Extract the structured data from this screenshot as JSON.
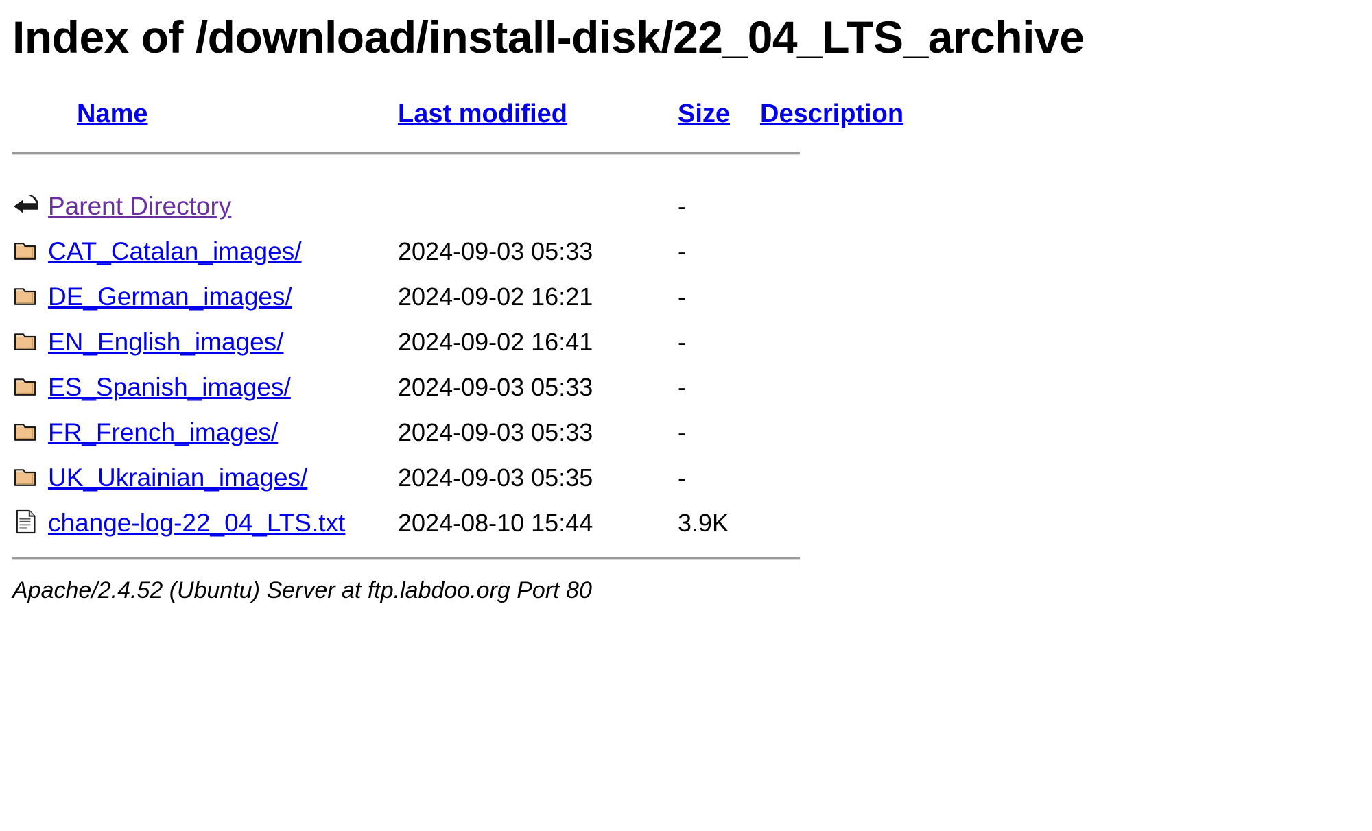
{
  "page": {
    "title": "Index of /download/install-disk/22_04_LTS_archive"
  },
  "table": {
    "headers": {
      "name": "Name",
      "last_modified": "Last modified",
      "size": "Size",
      "description": "Description"
    },
    "rows": [
      {
        "icon": "back-icon",
        "name": "Parent Directory",
        "last_modified": "",
        "size": "-",
        "description": "",
        "visited": true
      },
      {
        "icon": "folder-icon",
        "name": "CAT_Catalan_images/",
        "last_modified": "2024-09-03 05:33",
        "size": "-",
        "description": "",
        "visited": false
      },
      {
        "icon": "folder-icon",
        "name": "DE_German_images/",
        "last_modified": "2024-09-02 16:21",
        "size": "-",
        "description": "",
        "visited": false
      },
      {
        "icon": "folder-icon",
        "name": "EN_English_images/",
        "last_modified": "2024-09-02 16:41",
        "size": "-",
        "description": "",
        "visited": false
      },
      {
        "icon": "folder-icon",
        "name": "ES_Spanish_images/",
        "last_modified": "2024-09-03 05:33",
        "size": "-",
        "description": "",
        "visited": false
      },
      {
        "icon": "folder-icon",
        "name": "FR_French_images/",
        "last_modified": "2024-09-03 05:33",
        "size": "-",
        "description": "",
        "visited": false
      },
      {
        "icon": "folder-icon",
        "name": "UK_Ukrainian_images/",
        "last_modified": "2024-09-03 05:35",
        "size": "-",
        "description": "",
        "visited": false
      },
      {
        "icon": "text-file-icon",
        "name": "change-log-22_04_LTS.txt",
        "last_modified": "2024-08-10 15:44",
        "size": "3.9K",
        "description": "",
        "visited": false
      }
    ]
  },
  "footer": {
    "signature": "Apache/2.4.52 (Ubuntu) Server at ftp.labdoo.org Port 80"
  },
  "colors": {
    "link": "#0000ee",
    "visited_link": "#6a2fa0",
    "text": "#000000",
    "background": "#ffffff",
    "folder_fill": "#f0c18a",
    "rule": "#6e6e6e"
  }
}
